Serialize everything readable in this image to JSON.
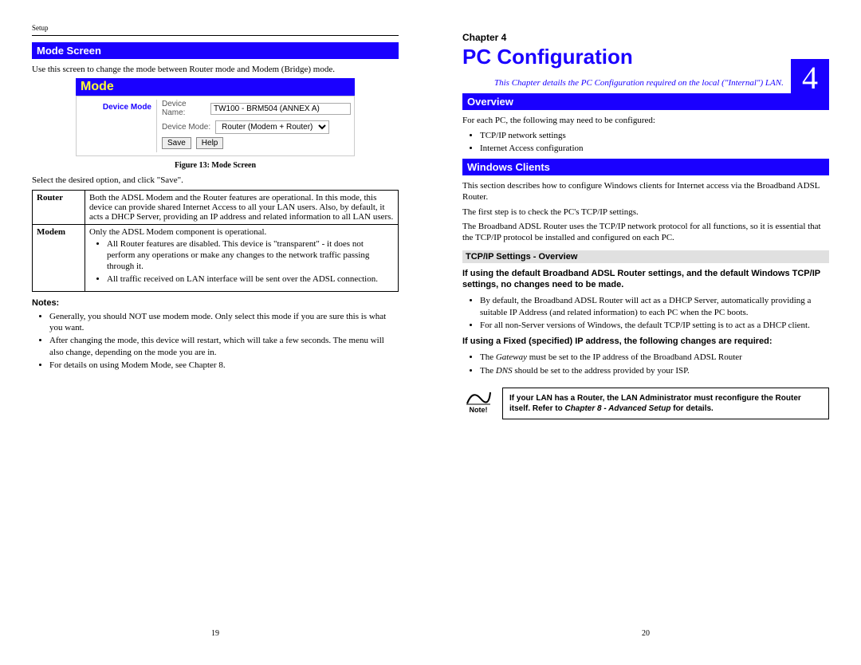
{
  "left": {
    "running_head": "Setup",
    "section_title": "Mode Screen",
    "intro": "Use this screen to change the mode between Router mode and Modem (Bridge) mode.",
    "figure": {
      "bar_label": "Mode",
      "side_label": "Device Mode",
      "row1_label": "Device Name:",
      "row1_value": "TW100 - BRM504 (ANNEX A)",
      "row2_label": "Device Mode:",
      "row2_value": "Router (Modem + Router)",
      "btn_save": "Save",
      "btn_help": "Help",
      "caption": "Figure 13: Mode Screen"
    },
    "after_fig": "Select the desired option, and click \"Save\".",
    "table": {
      "r1_label": "Router",
      "r1_text": "Both the ADSL Modem and the Router features are operational. In this mode, this device can provide shared Internet Access to all your LAN users. Also, by default, it acts a DHCP Server, providing an IP address and related information to all LAN users.",
      "r2_label": "Modem",
      "r2_text": "Only the ADSL Modem component is operational.",
      "r2_b1": "All Router features are disabled. This device is \"transparent\" - it does not perform any operations or make any changes to the network traffic passing through it.",
      "r2_b2": "All traffic received on LAN interface will be sent over the ADSL connection."
    },
    "notes_head": "Notes:",
    "notes": {
      "n1": "Generally, you should NOT use modem mode. Only select this mode if you are sure this is what you want.",
      "n2": "After changing the mode, this device will restart, which will take a few seconds. The menu will also change, depending on the mode you are in.",
      "n3": "For details on using Modem Mode, see Chapter 8."
    },
    "page_no": "19"
  },
  "right": {
    "chapter_label": "Chapter 4",
    "chapter_title": "PC Configuration",
    "chapter_number": "4",
    "chapter_blurb": "This Chapter details the PC Configuration required on the local (\"Internal\") LAN.",
    "overview_bar": "Overview",
    "overview_intro": "For each PC, the following may need to be configured:",
    "overview_items": {
      "i1": "TCP/IP network settings",
      "i2": "Internet Access configuration"
    },
    "windows_bar": "Windows Clients",
    "win_p1": "This section describes how to configure Windows clients for Internet access via the Broadband ADSL Router.",
    "win_p2": "The first step is to check the PC's TCP/IP settings.",
    "win_p3": "The Broadband ADSL Router uses the TCP/IP network protocol for all functions, so it is essential that the TCP/IP protocol be installed and configured on each PC.",
    "tcpip_head": "TCP/IP Settings - Overview",
    "tcpip_bold1": "If using the default Broadband ADSL Router settings, and the default Windows TCP/IP settings, no changes need to be made.",
    "tcpip_items": {
      "i1": "By default, the Broadband ADSL Router will act as a DHCP Server, automatically providing a suitable IP Address (and related information) to each PC when the PC boots.",
      "i2": "For all non-Server versions of Windows, the default TCP/IP setting is to act as a DHCP client."
    },
    "tcpip_bold2": "If using a Fixed (specified) IP address, the following changes are required:",
    "tcpip_fixed": {
      "i1_a": "The ",
      "i1_em": "Gateway",
      "i1_b": " must be set to the IP address of the Broadband ADSL Router",
      "i2_a": "The ",
      "i2_em": "DNS",
      "i2_b": " should be set to the address provided by your ISP."
    },
    "note": {
      "icon_label": "Note!",
      "t1": "If your LAN has a Router, the LAN Administrator must reconfigure the Router itself. Refer to ",
      "t_em": "Chapter 8 - Advanced Setup",
      "t2": " for details."
    },
    "page_no": "20"
  }
}
